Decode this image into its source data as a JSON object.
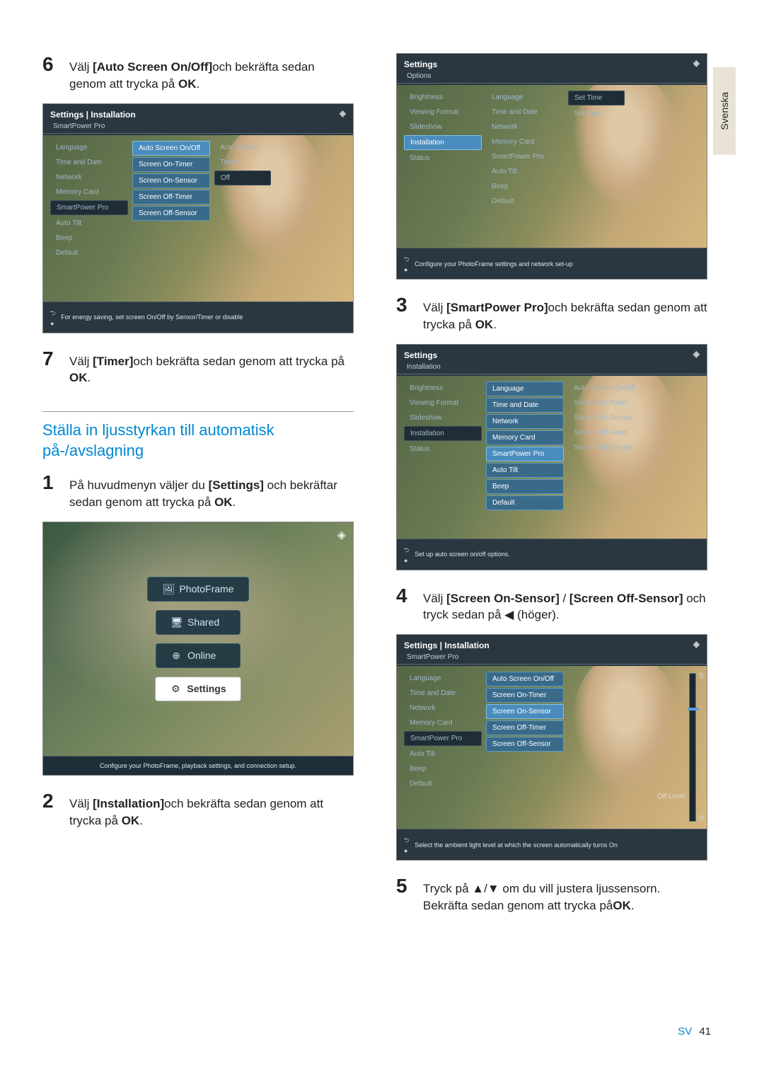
{
  "side_tab": "Svenska",
  "left": {
    "step6_a": "Välj ",
    "step6_b": "[Auto Screen On/Off]",
    "step6_c": "och bekräfta sedan genom att trycka på ",
    "step6_d": "OK",
    "step6_e": ".",
    "ss1": {
      "title": "Settings | Installation",
      "submenu": "SmartPower Pro",
      "col1": [
        "Language",
        "Time and Date",
        "Network",
        "Memory Card",
        "SmartPower Pro",
        "Auto Tilt",
        "Beep",
        "Default"
      ],
      "col2": [
        "Auto Screen On/Off",
        "Screen On-Timer",
        "Screen On-Sensor",
        "Screen Off-Timer",
        "Screen Off-Sensor"
      ],
      "col3": [
        "Auto Sensor",
        "Timer",
        "Off"
      ],
      "tip": "For energy saving, set screen On/Off by Sensor/Timer or disable"
    },
    "step7_a": "Välj ",
    "step7_b": "[Timer]",
    "step7_c": "och bekräfta sedan genom att trycka på ",
    "step7_d": "OK",
    "step7_e": ".",
    "heading": "Ställa in ljusstyrkan till automatisk på-/avslagning",
    "step1_a": "På huvudmenyn väljer du ",
    "step1_b": "[Settings]",
    "step1_c": " och bekräftar sedan genom att trycka på ",
    "step1_d": "OK",
    "step1_e": ".",
    "ss2": {
      "menu": [
        "PhotoFrame",
        "Shared",
        "Online",
        "Settings"
      ],
      "tip": "Configure your PhotoFrame, playback settings, and connection setup."
    },
    "step2_a": "Välj ",
    "step2_b": "[Installation]",
    "step2_c": "och bekräfta sedan genom att trycka på ",
    "step2_d": "OK",
    "step2_e": "."
  },
  "right": {
    "ss3": {
      "title": "Settings",
      "submenu": "Options",
      "col1": [
        "Brightness",
        "Viewing Format",
        "Slideshow",
        "Installation",
        "Status"
      ],
      "col2": [
        "Language",
        "Time and Date",
        "Network",
        "Memory Card",
        "SmartPower Pro",
        "Auto Tilt",
        "Beep",
        "Default"
      ],
      "col3": [
        "Set Time",
        "Set Date"
      ],
      "tip": "Configure your PhotoFrame settings and network set-up"
    },
    "step3_a": "Välj ",
    "step3_b": "[SmartPower Pro]",
    "step3_c": "och bekräfta sedan genom att trycka på ",
    "step3_d": "OK",
    "step3_e": ".",
    "ss4": {
      "title": "Settings",
      "submenu": "Installation",
      "col1": [
        "Brightness",
        "Viewing Format",
        "Slideshow",
        "Installation",
        "Status"
      ],
      "col2": [
        "Language",
        "Time and Date",
        "Network",
        "Memory Card",
        "SmartPower Pro",
        "Auto Tilt",
        "Beep",
        "Default"
      ],
      "col3": [
        "Auto Screen On/Off",
        "Screen On-Timer",
        "Screen On-Sensor",
        "Screen Off-Timer",
        "Screen Off-Sensor"
      ],
      "tip": "Set up auto screen on/off options."
    },
    "step4_a": "Välj ",
    "step4_b": "[Screen On-Sensor]",
    "step4_c": " / ",
    "step4_d": "[Screen Off-Sensor]",
    "step4_e": " och tryck sedan på ◀ (höger).",
    "ss5": {
      "title": "Settings | Installation",
      "submenu": "SmartPower Pro",
      "col1": [
        "Language",
        "Time and Date",
        "Network",
        "Memory Card",
        "SmartPower Pro",
        "Auto Tilt",
        "Beep",
        "Default"
      ],
      "col2": [
        "Auto Screen On/Off",
        "Screen On-Timer",
        "Screen On-Sensor",
        "Screen Off-Timer",
        "Screen Off-Sensor"
      ],
      "slider": {
        "top": "5",
        "bottom": "0",
        "label": "Off Level"
      },
      "tip": "Select the ambient light level at which the screen automatically turns On"
    },
    "step5_a": "Tryck på ▲/▼ om du vill justera ljussensorn. Bekräfta sedan genom att trycka på",
    "step5_b": "OK",
    "step5_c": "."
  },
  "footer": {
    "sv": "SV",
    "page": "41"
  },
  "nums": {
    "n6": "6",
    "n7": "7",
    "n1": "1",
    "n2": "2",
    "n3": "3",
    "n4": "4",
    "n5": "5"
  }
}
